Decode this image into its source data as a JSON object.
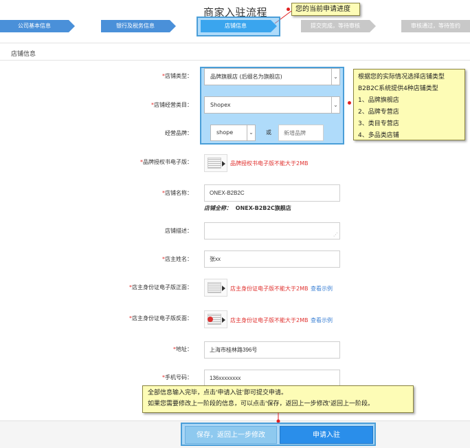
{
  "header": {
    "title": "商家入驻流程",
    "progress_callout": "您的当前申请进度"
  },
  "steps": [
    {
      "label": "公司基本信息"
    },
    {
      "label": "银行及税务信息"
    },
    {
      "label": "店铺信息"
    },
    {
      "label": "提交完成，等待审核"
    },
    {
      "label": "审核通过，等待签约"
    }
  ],
  "section": {
    "title": "店铺信息"
  },
  "form": {
    "required_mark": "*",
    "store_type": {
      "label": "店铺类型：",
      "value": "品牌旗舰店 (后缀名为旗舰店)"
    },
    "category": {
      "label": "店铺经营类目：",
      "value": "Shopex"
    },
    "brand": {
      "label": "经营品牌：",
      "value": "shope",
      "or": "或",
      "new_brand_placeholder": "新增品牌"
    },
    "brand_auth": {
      "label": "品牌授权书电子版：",
      "warning": "品牌授权书电子版不能大于2MB"
    },
    "store_name": {
      "label": "店铺名称：",
      "value": "ONEX-B2B2C",
      "fullname_label": "店铺全称：",
      "fullname_value": "ONEX-B2B2C旗舰店"
    },
    "store_desc": {
      "label": "店铺描述：",
      "value": ""
    },
    "owner_name": {
      "label": "店主姓名：",
      "value": "张xx"
    },
    "id_front": {
      "label": "店主身份证电子版正面：",
      "warning": "店主身份证电子版不能大于2MB",
      "link": "查看示例"
    },
    "id_back": {
      "label": "店主身份证电子版反面：",
      "warning": "店主身份证电子版不能大于2MB",
      "link": "查看示例"
    },
    "address": {
      "label": "地址：",
      "value": "上海市桂林路396号"
    },
    "phone": {
      "label": "手机号码：",
      "value": "136xxxxxxxx"
    }
  },
  "callouts": {
    "store_type_lines": [
      "根据您的实际情况选择店铺类型",
      "B2B2C系统提供4种店铺类型",
      "1、品牌旗舰店",
      "2、品牌专营店",
      "3、类目专营店",
      "4、多品类店铺"
    ],
    "bottom_lines": [
      "全部信息输入完毕，点击'申请入驻'即可提交申请。",
      "如果您需要修改上一阶段的信息，可以点击'保存，返回上一步修改'返回上一阶段。"
    ]
  },
  "buttons": {
    "save": "保存，返回上一步修改",
    "apply": "申请入驻"
  },
  "colors": {
    "step_done": "#4a90d9",
    "step_current": "#3aa5ee",
    "step_pending": "#c8c8c8",
    "callout_bg": "#fdfcb6",
    "warning": "#e0302e",
    "primary_button": "#2a8eea"
  }
}
